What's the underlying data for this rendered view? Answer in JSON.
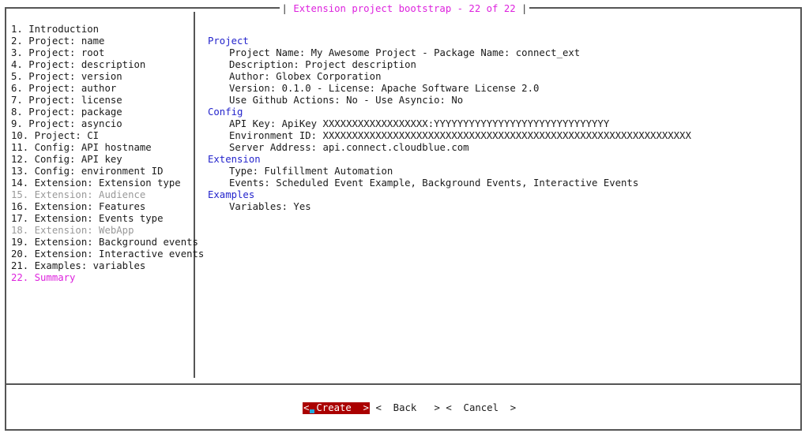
{
  "window": {
    "title": "Extension project bootstrap - 22 of 22"
  },
  "sidebar": {
    "items": [
      {
        "label": "1. Introduction",
        "state": "normal"
      },
      {
        "label": "2. Project: name",
        "state": "normal"
      },
      {
        "label": "3. Project: root",
        "state": "normal"
      },
      {
        "label": "4. Project: description",
        "state": "normal"
      },
      {
        "label": "5. Project: version",
        "state": "normal"
      },
      {
        "label": "6. Project: author",
        "state": "normal"
      },
      {
        "label": "7. Project: license",
        "state": "normal"
      },
      {
        "label": "8. Project: package",
        "state": "normal"
      },
      {
        "label": "9. Project: asyncio",
        "state": "normal"
      },
      {
        "label": "10. Project: CI",
        "state": "normal"
      },
      {
        "label": "11. Config: API hostname",
        "state": "normal"
      },
      {
        "label": "12. Config: API key",
        "state": "normal"
      },
      {
        "label": "13. Config: environment ID",
        "state": "normal"
      },
      {
        "label": "14. Extension: Extension type",
        "state": "normal"
      },
      {
        "label": "15. Extension: Audience",
        "state": "disabled"
      },
      {
        "label": "16. Extension: Features",
        "state": "normal"
      },
      {
        "label": "17. Extension: Events type",
        "state": "normal"
      },
      {
        "label": "18. Extension: WebApp",
        "state": "disabled"
      },
      {
        "label": "19. Extension: Background events",
        "state": "normal"
      },
      {
        "label": "20. Extension: Interactive events",
        "state": "normal"
      },
      {
        "label": "21. Examples: variables",
        "state": "normal"
      },
      {
        "label": "22. Summary",
        "state": "active"
      }
    ]
  },
  "summary": {
    "project": {
      "heading": "Project",
      "lines": [
        "Project Name: My Awesome Project - Package Name: connect_ext",
        "Description: Project description",
        "Author: Globex Corporation",
        "Version: 0.1.0 - License: Apache Software License 2.0",
        "Use Github Actions: No - Use Asyncio: No"
      ]
    },
    "config": {
      "heading": "Config",
      "lines": [
        "API Key: ApiKey XXXXXXXXXXXXXXXXXX:YYYYYYYYYYYYYYYYYYYYYYYYYYYYYY",
        "Environment ID: XXXXXXXXXXXXXXXXXXXXXXXXXXXXXXXXXXXXXXXXXXXXXXXXXXXXXXXXXXXXXXX",
        "Server Address: api.connect.cloudblue.com"
      ]
    },
    "extension": {
      "heading": "Extension",
      "lines": [
        "Type: Fulfillment Automation",
        "Events: Scheduled Event Example, Background Events, Interactive Events"
      ]
    },
    "examples": {
      "heading": "Examples",
      "lines": [
        "Variables: Yes"
      ]
    }
  },
  "buttons": {
    "create": "Create",
    "back": "Back",
    "cancel": "Cancel"
  },
  "colors": {
    "accent": "#dd22dd",
    "section": "#2424cc",
    "selected_button": "#aa0000",
    "disabled": "#999999"
  }
}
